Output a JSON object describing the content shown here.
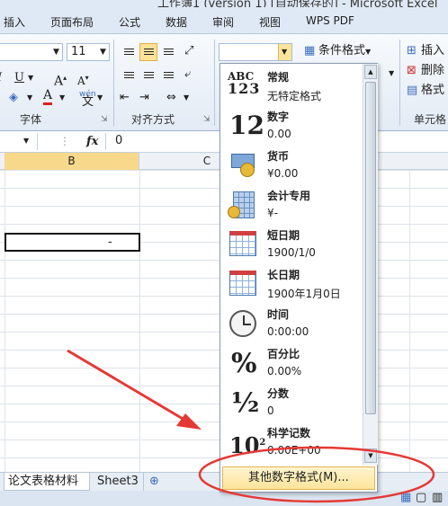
{
  "window": {
    "title": "工作簿1 (version 1) [自动保存的] - Microsoft Excel"
  },
  "tabs": [
    "插入",
    "页面布局",
    "公式",
    "数据",
    "审阅",
    "视图",
    "WPS PDF"
  ],
  "ribbon": {
    "font_size": "11",
    "font_group_label": "字体",
    "alignment_group_label": "对齐方式",
    "cells_group_label": "单元格",
    "conditional_format_label": "条件格式",
    "insert_label": "插入",
    "delete_label": "删除",
    "format_label": "格式",
    "wen_label": "wén"
  },
  "formula_bar": {
    "fx": "fx",
    "value": "0"
  },
  "columns": [
    "B",
    "C"
  ],
  "number_format_menu": {
    "items": [
      {
        "name": "常规",
        "sample": "无特定格式",
        "icon": "abc-123-icon"
      },
      {
        "name": "数字",
        "sample": "0.00",
        "icon": "number-12-icon"
      },
      {
        "name": "货币",
        "sample": "¥0.00",
        "icon": "currency-icon"
      },
      {
        "name": "会计专用",
        "sample": "¥-",
        "icon": "accounting-icon"
      },
      {
        "name": "短日期",
        "sample": "1900/1/0",
        "icon": "calendar-icon"
      },
      {
        "name": "长日期",
        "sample": "1900年1月0日",
        "icon": "calendar-icon"
      },
      {
        "name": "时间",
        "sample": "0:00:00",
        "icon": "clock-icon"
      },
      {
        "name": "百分比",
        "sample": "0.00%",
        "icon": "percent-icon"
      },
      {
        "name": "分数",
        "sample": "0",
        "icon": "fraction-icon"
      },
      {
        "name": "科学记数",
        "sample": "0.00E+00",
        "icon": "scientific-icon"
      }
    ],
    "more_label": "其他数字格式(M)..."
  },
  "sheet_tabs": [
    "论文表格材料",
    "Sheet3"
  ],
  "selected_cell_value": "-",
  "colors": {
    "accent": "#fde49a",
    "annotation": "#e53935"
  }
}
